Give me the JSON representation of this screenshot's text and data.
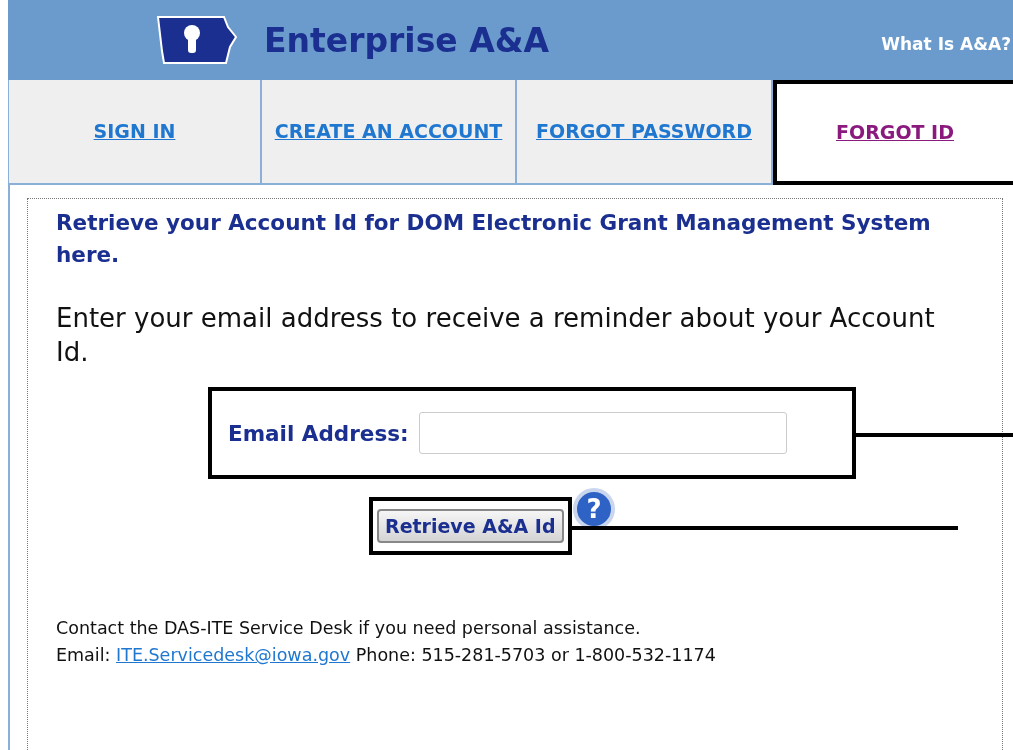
{
  "header": {
    "title": "Enterprise A&A",
    "link": "What Is A&A?"
  },
  "tabs": [
    {
      "label": "SIGN IN",
      "selected": false
    },
    {
      "label": "CREATE AN ACCOUNT",
      "selected": false
    },
    {
      "label": "FORGOT PASSWORD",
      "selected": false
    },
    {
      "label": "FORGOT ID",
      "selected": true
    }
  ],
  "heading": "Retrieve your Account Id for DOM Electronic Grant Management System here.",
  "intro": "Enter your email address to receive a reminder about your Account Id.",
  "email_field": {
    "label": "Email Address:"
  },
  "submit_button": "Retrieve A&A Id",
  "help_icon": "?",
  "contact": {
    "line_1": "Contact the DAS-ITE Service Desk if you need personal assistance.",
    "email_prefix": "Email:",
    "email": "ITE.Servicedesk@iowa.gov",
    "phone": "Phone: 515-281-5703 or 1-800-532-1174"
  }
}
